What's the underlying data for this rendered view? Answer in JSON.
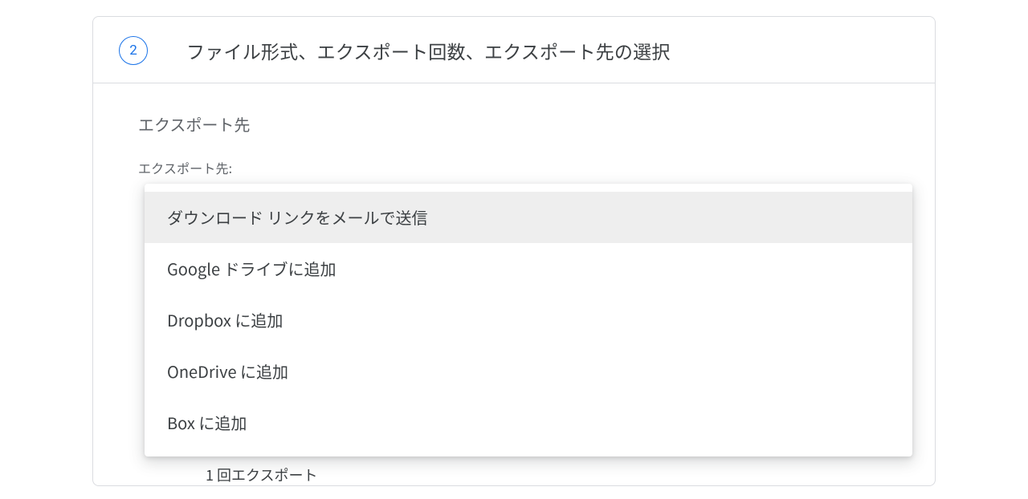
{
  "step": {
    "number": "2",
    "title": "ファイル形式、エクスポート回数、エクスポート先の選択"
  },
  "section": {
    "heading": "エクスポート先",
    "fieldLabel": "エクスポート先:"
  },
  "options": {
    "selectedIndex": 0,
    "items": [
      "ダウンロード リンクをメールで送信",
      "Google ドライブに追加",
      "Dropbox に追加",
      "OneDrive に追加",
      "Box に追加"
    ]
  },
  "frequency": {
    "label": "1 回エクスポート"
  }
}
